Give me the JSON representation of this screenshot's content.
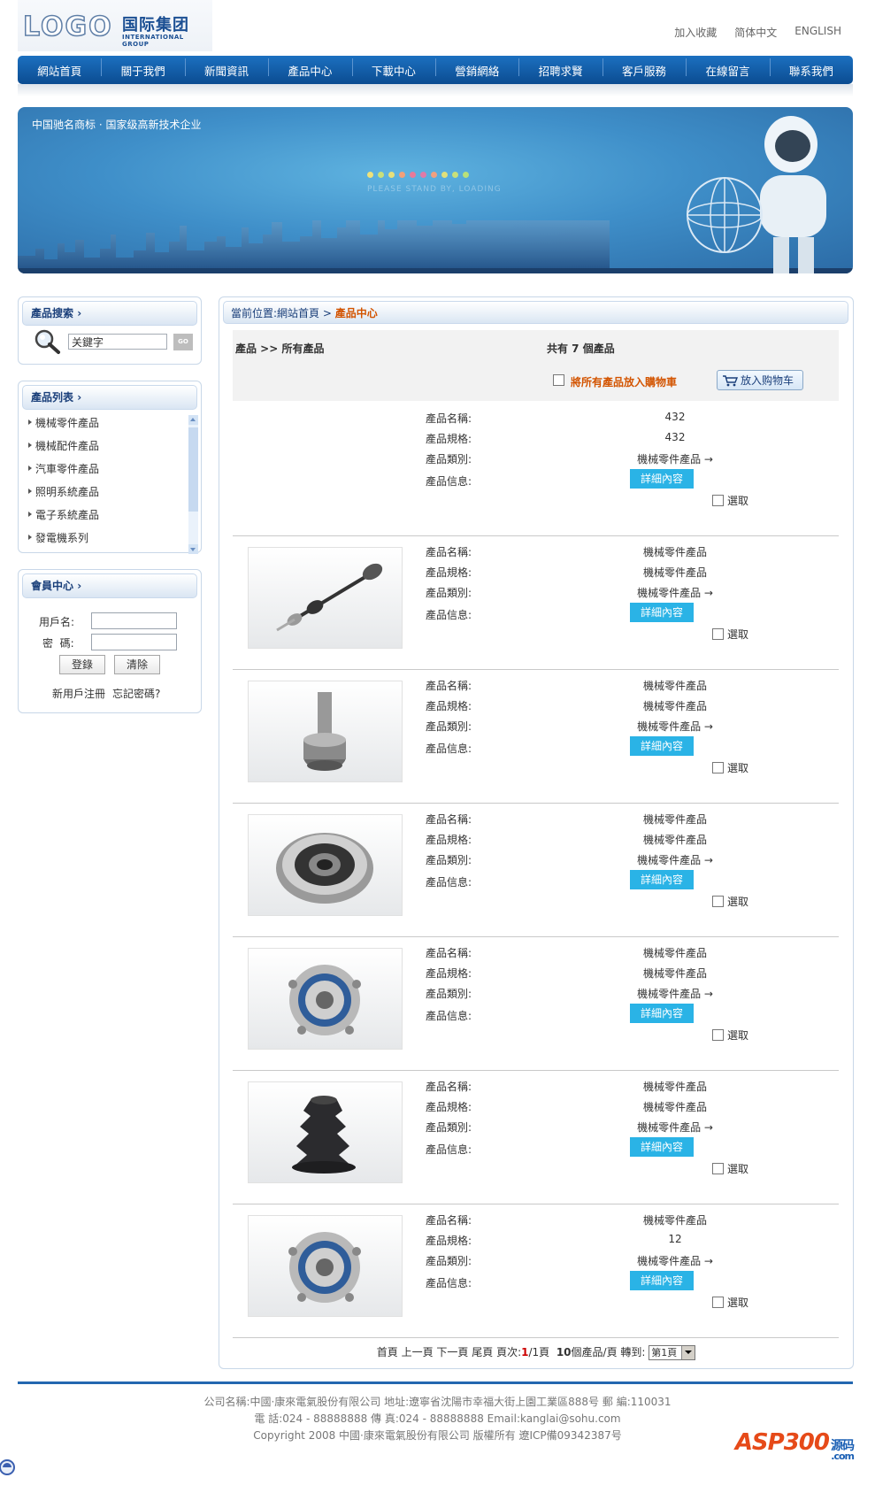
{
  "header": {
    "logo_text": "LOGO",
    "logo_cn": "国际集团",
    "logo_en": "INTERNATIONAL GROUP",
    "top_links": [
      "加入收藏",
      "简体中文",
      "ENGLISH"
    ]
  },
  "nav": {
    "items": [
      "網站首頁",
      "關于我們",
      "新聞資訊",
      "產品中心",
      "下載中心",
      "營銷網絡",
      "招聘求賢",
      "客戶服務",
      "在線留言",
      "聯系我們"
    ]
  },
  "banner": {
    "slogan": "中国驰名商标 · 国家级高新技术企业",
    "loading": "PLEASE STAND BY, LOADING",
    "dot_colors": [
      "#f0e27a",
      "#c9e07a",
      "#e8e07a",
      "#f2a07a",
      "#e87a9a",
      "#e07aa8",
      "#f0a080",
      "#e0e07a",
      "#c8e07a",
      "#b8e07a"
    ]
  },
  "sidebar": {
    "search": {
      "title": "產品搜索",
      "placeholder": "关鍵字",
      "go": "GO"
    },
    "product_list": {
      "title": "產品列表",
      "items": [
        "機械零件產品",
        "機械配件產品",
        "汽車零件產品",
        "照明系統產品",
        "電子系統產品",
        "發電機系列"
      ]
    },
    "member": {
      "title": "會員中心",
      "username_label": "用戶名:",
      "password_label": "密  碼:",
      "login": "登錄",
      "clear": "清除",
      "register": "新用戶注冊",
      "forgot": "忘記密碼?"
    }
  },
  "main": {
    "breadcrumb_prefix": "當前位置:網站首頁 > ",
    "breadcrumb_current": "產品中心",
    "list_title": "產品 >> 所有產品",
    "count_text": "共有 7 個產品",
    "all_to_cart": "將所有產品放入購物車",
    "cart_button": "放入购物车",
    "labels": {
      "name": "產品名稱:",
      "spec": "產品規格:",
      "category": "產品類別:",
      "info": "產品信息:"
    },
    "detail_button": "詳細內容",
    "select_label": "選取",
    "products": [
      {
        "name": "432",
        "spec": "432",
        "category": "機械零件產品 →",
        "image": ""
      },
      {
        "name": "機械零件產品",
        "spec": "機械零件產品",
        "category": "機械零件產品 →",
        "image": "drive-shaft"
      },
      {
        "name": "機械零件產品",
        "spec": "機械零件產品",
        "category": "機械零件產品 →",
        "image": "cv-joint"
      },
      {
        "name": "機械零件產品",
        "spec": "機械零件產品",
        "category": "機械零件產品 →",
        "image": "bearing"
      },
      {
        "name": "機械零件產品",
        "spec": "機械零件產品",
        "category": "機械零件產品 →",
        "image": "wheel-hub"
      },
      {
        "name": "機械零件產品",
        "spec": "機械零件產品",
        "category": "機械零件產品 →",
        "image": "rubber-boot"
      },
      {
        "name": "機械零件產品",
        "spec": "12",
        "category": "機械零件產品 →",
        "image": "wheel-hub"
      }
    ],
    "pager": {
      "first": "首頁",
      "prev": "上一頁",
      "next": "下一頁",
      "last": "尾頁",
      "page_label": "頁次:",
      "current": "1",
      "total": "/1頁",
      "per_page": "10",
      "per_page_suffix": "個產品/頁",
      "jump_label": "轉到:",
      "jump_value": "第1頁"
    }
  },
  "footer": {
    "line1": "公司名稱:中國·康來電氣股份有限公司 地址:遼寧省沈陽市幸福大街上園工業區888号 郵 編:110031",
    "line2": "電 話:024 - 88888888 傳 真:024 - 88888888 Email:kanglai@sohu.com",
    "line3": "Copyright 2008 中國·康來電氣股份有限公司 版權所有 遼ICP備09342387号",
    "watermark": "ASP300",
    "watermark_suffix": "源码",
    "watermark_domain": ".com"
  }
}
